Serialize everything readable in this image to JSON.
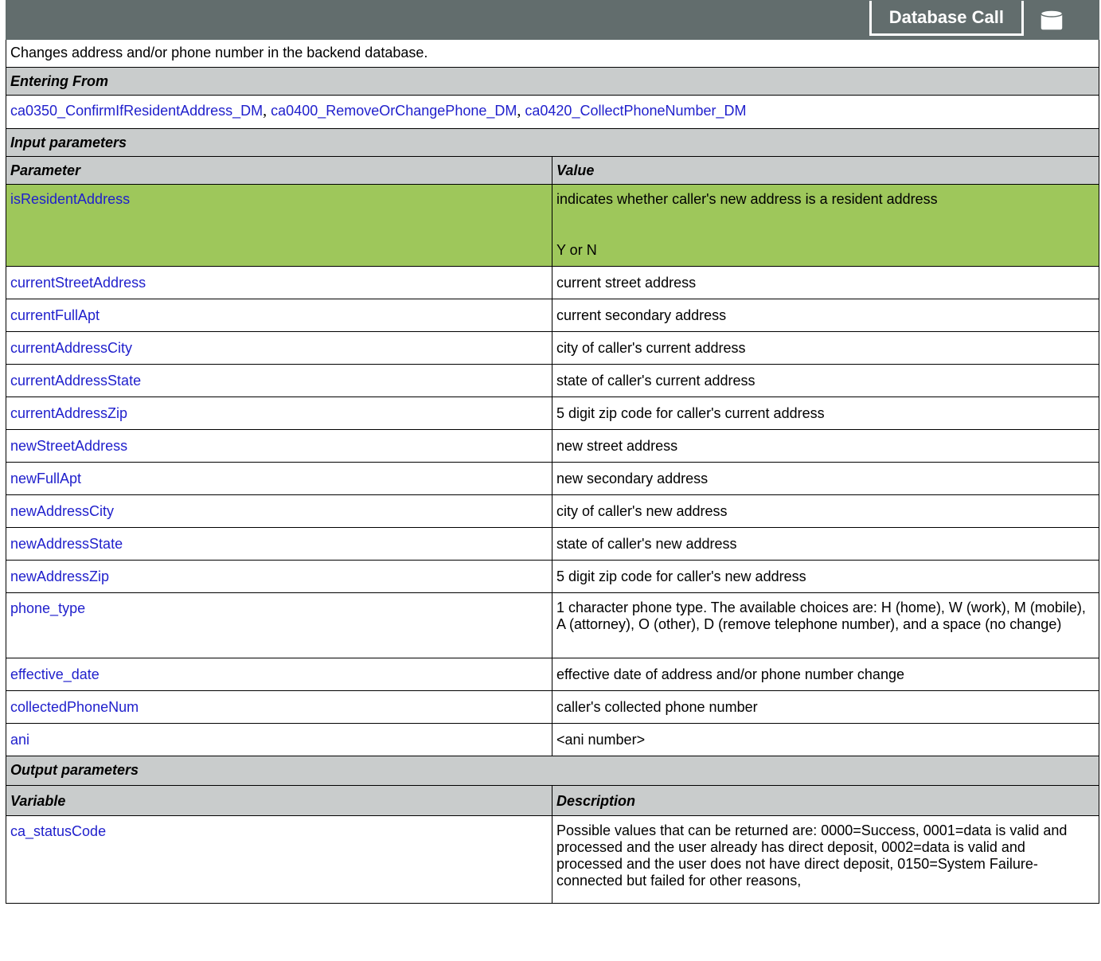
{
  "header": {
    "title": "Database Call",
    "icon": "database-icon"
  },
  "description": "Changes address and/or phone number in the backend database.",
  "entering_from": {
    "label": "Entering From",
    "links": [
      "ca0350_ConfirmIfResidentAddress_DM",
      "ca0400_RemoveOrChangePhone_DM",
      "ca0420_CollectPhoneNumber_DM"
    ],
    "separator": ","
  },
  "input": {
    "label": "Input parameters",
    "col1": "Parameter",
    "col2": "Value",
    "rows": [
      {
        "name": "isResidentAddress",
        "value": "indicates whether caller's new address is a resident address",
        "value2": "Y or N"
      },
      {
        "name": "currentStreetAddress",
        "value": "current street address"
      },
      {
        "name": "currentFullApt",
        "value": "current secondary address"
      },
      {
        "name": "currentAddressCity",
        "value": "city of caller's current address"
      },
      {
        "name": "currentAddressState",
        "value": "state of caller's current address"
      },
      {
        "name": "currentAddressZip",
        "value": "5 digit zip code for caller's current address"
      },
      {
        "name": "newStreetAddress",
        "value": "new street address"
      },
      {
        "name": "newFullApt",
        "value": "new secondary address"
      },
      {
        "name": "newAddressCity",
        "value": "city of caller's new address"
      },
      {
        "name": "newAddressState",
        "value": "state of caller's new address"
      },
      {
        "name": "newAddressZip",
        "value": "5 digit zip code for caller's new address"
      },
      {
        "name": "phone_type",
        "value": "1 character phone type. The available choices are:  H (home), W (work), M (mobile), A (attorney), O (other), D (remove telephone number), and a space (no change)"
      },
      {
        "name": "effective_date",
        "value": "effective date of address and/or phone number change"
      },
      {
        "name": "collectedPhoneNum",
        "value": "caller's collected phone number"
      },
      {
        "name": "ani",
        "value": "<ani number>"
      }
    ]
  },
  "output": {
    "label": "Output parameters",
    "col1": "Variable",
    "col2": "Description",
    "rows": [
      {
        "name": "ca_statusCode",
        "value": "Possible values that can be returned are: 0000=Success, 0001=data is valid and processed and the user already has direct deposit, 0002=data is valid and processed and the user does not have direct deposit, 0150=System Failure-connected but failed for other reasons,"
      }
    ]
  }
}
